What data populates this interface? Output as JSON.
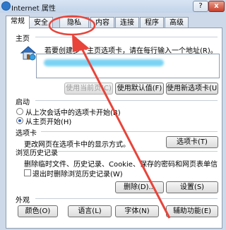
{
  "window": {
    "title": "Internet 属性",
    "help": "?",
    "close": "x"
  },
  "tabs": [
    "常规",
    "安全",
    "隐私",
    "内容",
    "连接",
    "程序",
    "高级"
  ],
  "homepage": {
    "section": "主页",
    "instruction": "若要创建多个主页选项卡，请在每行输入一个地址(R)。",
    "use_current": "使用当前页(C)",
    "use_default": "使用默认值(F)",
    "use_new_tab": "使用新选项卡(U)"
  },
  "startup": {
    "section": "启动",
    "option1": "从上次会话中的选项卡开始(B)",
    "option2": "从主页开始(H)"
  },
  "tabs_section": {
    "section": "选项卡",
    "description": "更改网页在选项卡中的显示方式。",
    "button": "选项卡(T)"
  },
  "history": {
    "section": "浏览历史记录",
    "description": "删除临时文件、历史记录、Cookie、保存的密码和网页表单信息。",
    "checkbox": "退出时删除浏览历史记录(W)",
    "delete": "删除(D)...",
    "settings": "设置(S)"
  },
  "appearance": {
    "section": "外观",
    "colors": "颜色(O)",
    "languages": "语言(L)",
    "fonts": "字体(N)",
    "accessibility": "辅助功能(E)"
  },
  "colors": {
    "annotation": "#e8443a",
    "radio": "#2a5ebd",
    "titlebar": "#c8d7eb"
  }
}
